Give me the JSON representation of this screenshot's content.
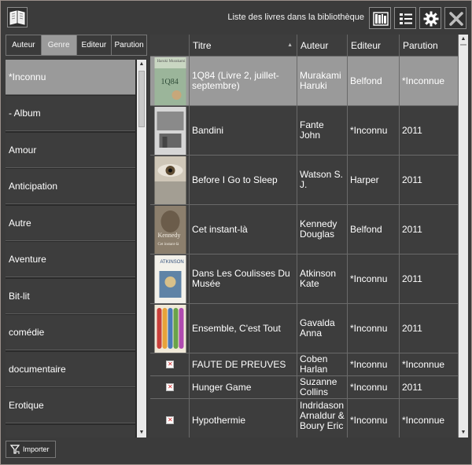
{
  "window": {
    "title": "Liste des livres dans la bibliothèque"
  },
  "toolbar": {
    "icons": [
      "book-icon",
      "library-shelf-icon",
      "list-icon",
      "gear-icon",
      "close-icon"
    ]
  },
  "tabs": [
    {
      "label": "Auteur",
      "active": false
    },
    {
      "label": "Genre",
      "active": true
    },
    {
      "label": "Editeur",
      "active": false
    },
    {
      "label": "Parution",
      "active": false
    }
  ],
  "genres": [
    {
      "label": "*Inconnu",
      "selected": true
    },
    {
      "label": "- Album",
      "selected": false
    },
    {
      "label": "Amour",
      "selected": false
    },
    {
      "label": "Anticipation",
      "selected": false
    },
    {
      "label": "Autre",
      "selected": false
    },
    {
      "label": "Aventure",
      "selected": false
    },
    {
      "label": "Bit-lit",
      "selected": false
    },
    {
      "label": "comédie",
      "selected": false
    },
    {
      "label": "documentaire",
      "selected": false
    },
    {
      "label": "Erotique",
      "selected": false
    }
  ],
  "table": {
    "columns": [
      "Titre",
      "Auteur",
      "Editeur",
      "Parution"
    ],
    "sort_indicator": "▲",
    "rows": [
      {
        "title": "1Q84 (Livre 2, juillet-septembre)",
        "author": "Murakami Haruki",
        "publisher": "Belfond",
        "year": "*Inconnue",
        "cover": "cover-1q84",
        "selected": true
      },
      {
        "title": "Bandini",
        "author": "Fante John",
        "publisher": "*Inconnu",
        "year": "2011",
        "cover": "cover-bandini",
        "selected": false
      },
      {
        "title": "Before I Go to Sleep",
        "author": "Watson S. J.",
        "publisher": "Harper",
        "year": "2011",
        "cover": "cover-before-i-go-to-sleep",
        "selected": false
      },
      {
        "title": "Cet instant-là",
        "author": "Kennedy Douglas",
        "publisher": "Belfond",
        "year": "2011",
        "cover": "cover-cet-instant-la",
        "selected": false
      },
      {
        "title": "Dans Les Coulisses Du Musée",
        "author": "Atkinson Kate",
        "publisher": "*Inconnu",
        "year": "2011",
        "cover": "cover-dans-les-coulisses",
        "selected": false
      },
      {
        "title": "Ensemble, C'est Tout",
        "author": "Gavalda Anna",
        "publisher": "*Inconnu",
        "year": "2011",
        "cover": "cover-ensemble-cest-tout",
        "selected": false
      },
      {
        "title": "FAUTE DE PREUVES",
        "author": "Coben Harlan",
        "publisher": "*Inconnu",
        "year": "*Inconnue",
        "cover": "broken-image-icon",
        "selected": false
      },
      {
        "title": "Hunger Game",
        "author": "Suzanne Collins",
        "publisher": "*Inconnu",
        "year": "2011",
        "cover": "broken-image-icon",
        "selected": false
      },
      {
        "title": "Hypothermie",
        "author": "Indridason Arnaldur & Boury Eric",
        "publisher": "*Inconnu",
        "year": "*Inconnue",
        "cover": "broken-image-icon",
        "selected": false
      }
    ]
  },
  "cover_texts": {
    "cover_1q84_author": "Haruki Murakami",
    "cover_1q84_title": "1Q84",
    "cover_kennedy_author": "Kennedy",
    "cover_kennedy_title": "Cet instant-là",
    "cover_atkinson_author": "ATKINSON"
  },
  "footer": {
    "import_label": "Importer"
  }
}
